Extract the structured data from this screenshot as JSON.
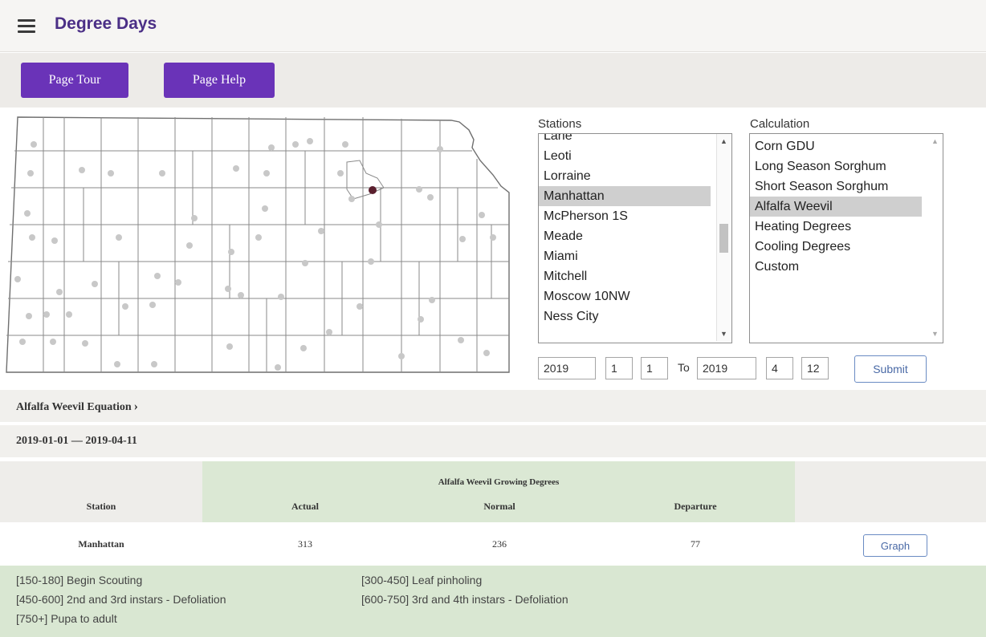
{
  "header": {
    "title": "Degree Days",
    "menu_icon": "hamburger-menu-icon"
  },
  "toolbar": {
    "tour_label": "Page Tour",
    "help_label": "Page Help",
    "button_color": "#6a33b8"
  },
  "map": {
    "selected_station": "Manhattan",
    "station_color": "#c8c8c8",
    "selected_color": "#5a1f2e"
  },
  "stations": {
    "label": "Stations",
    "items": [
      "Lane",
      "Leoti",
      "Lorraine",
      "Manhattan",
      "McPherson 1S",
      "Meade",
      "Miami",
      "Mitchell",
      "Moscow 10NW",
      "Ness City"
    ],
    "selected": "Manhattan"
  },
  "calculation": {
    "label": "Calculation",
    "items": [
      "Corn GDU",
      "Long Season Sorghum",
      "Short Season Sorghum",
      "Alfalfa Weevil",
      "Heating Degrees",
      "Cooling Degrees",
      "Custom"
    ],
    "selected": "Alfalfa Weevil"
  },
  "dates": {
    "start_year": "2019",
    "start_month": "1",
    "start_day": "1",
    "to_label": "To",
    "end_year": "2019",
    "end_month": "4",
    "end_day": "12"
  },
  "submit_label": "Submit",
  "equation": {
    "label": "Alfalfa Weevil Equation",
    "chevron": "›"
  },
  "date_range": "2019-01-01 — 2019-04-11",
  "table": {
    "group_header": "Alfalfa Weevil Growing Degrees",
    "columns": {
      "station": "Station",
      "actual": "Actual",
      "normal": "Normal",
      "departure": "Departure"
    },
    "rows": [
      {
        "station": "Manhattan",
        "actual": "313",
        "normal": "236",
        "departure": "77",
        "graph_label": "Graph"
      }
    ]
  },
  "legend": [
    "[150-180] Begin Scouting",
    "[300-450] Leaf pinholing",
    "[450-600] 2nd and 3rd instars - Defoliation",
    "[600-750] 3rd and 4th instars - Defoliation",
    "[750+] Pupa to adult"
  ]
}
